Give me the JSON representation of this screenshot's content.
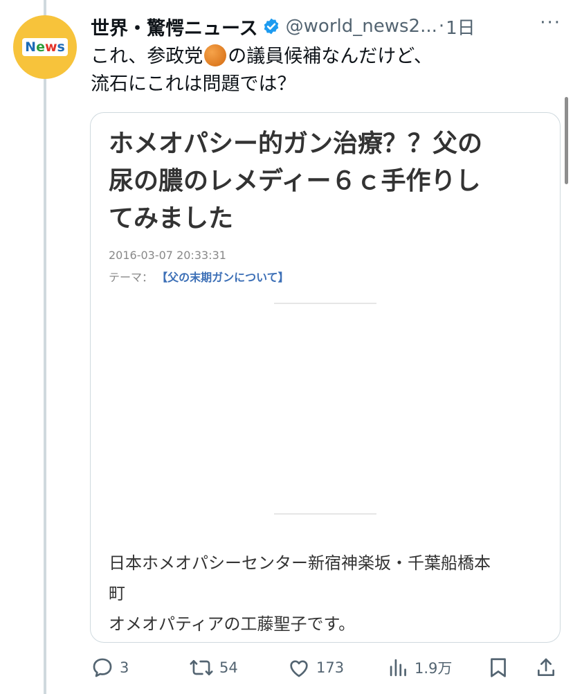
{
  "tweet": {
    "author_name": "世界・驚愕ニュース",
    "handle": "@world_news2...",
    "separator": "·",
    "time": "1日",
    "more": "···",
    "avatar_text": {
      "n": "N",
      "e": "e",
      "w": "w",
      "s": "s"
    },
    "text_line1_a": "これ、参政党",
    "text_line1_b": "の議員候補なんだけど、",
    "text_line2": "流石にこれは問題では？"
  },
  "card": {
    "title_line1": "ホメオパシー的ガン治療？？父の",
    "title_line2": "尿の膿のレメディー６ｃ手作りし",
    "title_line3": "てみました",
    "date": "2016-03-07 20:33:31",
    "theme_label": "テーマ：",
    "theme_link": "【父の末期ガンについて】",
    "body_line1": "日本ホメオパシーセンター新宿神楽坂・千葉船橋本",
    "body_line2": "町",
    "body_line3": "オメオパティアの工藤聖子です。"
  },
  "actions": {
    "replies": "3",
    "retweets": "54",
    "likes": "173",
    "views": "1.9万"
  },
  "colors": {
    "verified": "#1d9bf0",
    "secondary_text": "#536471",
    "avatar_bg": "#f7c33b"
  },
  "icons": [
    "verified-badge-icon",
    "reply-icon",
    "retweet-icon",
    "like-icon",
    "views-icon",
    "bookmark-icon",
    "share-icon",
    "orange-circle-emoji"
  ]
}
